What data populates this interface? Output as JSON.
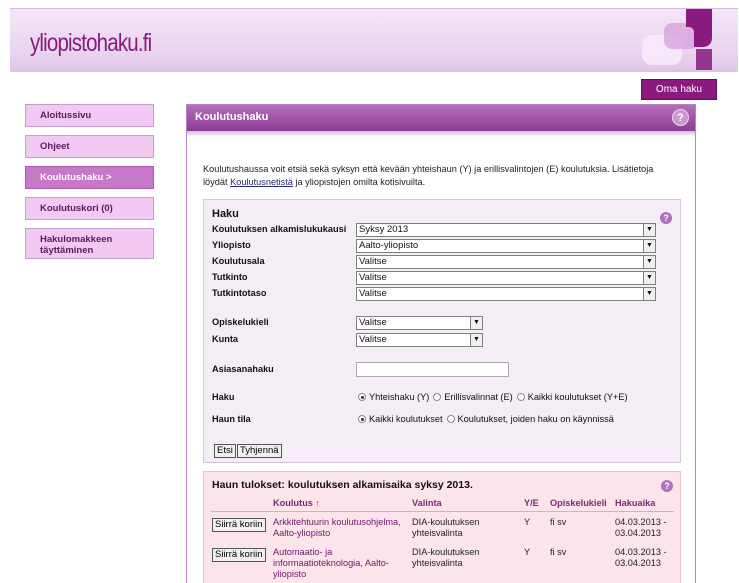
{
  "header": {
    "logo": "yliopistohaku.fi",
    "oma_haku": "Oma haku"
  },
  "sidebar": {
    "items": [
      {
        "label": "Aloitussivu"
      },
      {
        "label": "Ohjeet"
      },
      {
        "label": "Koulutushaku >"
      },
      {
        "label": "Koulutuskori (0)"
      },
      {
        "label": "Hakulomakkeen täyttäminen"
      }
    ]
  },
  "panel": {
    "title": "Koulutushaku",
    "help": "?",
    "intro_text": "Koulutushaussa voit etsiä sekä syksyn että kevään yhteishaun (Y) ja erillisvalintojen (E) koulutuksia. Lisätietoja löydät ",
    "intro_link": "Koulutusnetistä",
    "intro_tail": " ja yliopistojen omilta kotisivuilta."
  },
  "haku": {
    "title": "Haku",
    "help": "?",
    "fields": {
      "alkamis": {
        "label": "Koulutuksen alkamislukukausi",
        "value": "Syksy 2013"
      },
      "yliopisto": {
        "label": "Yliopisto",
        "value": "Aalto-yliopisto"
      },
      "ala": {
        "label": "Koulutusala",
        "value": "Valitse"
      },
      "tutkinto": {
        "label": "Tutkinto",
        "value": "Valitse"
      },
      "taso": {
        "label": "Tutkintotaso",
        "value": "Valitse"
      },
      "kieli": {
        "label": "Opiskelukieli",
        "value": "Valitse"
      },
      "kunta": {
        "label": "Kunta",
        "value": "Valitse"
      },
      "asiasana": {
        "label": "Asiasanahaku",
        "value": ""
      }
    },
    "haku_label": "Haku",
    "haku_options": [
      "Yhteishaku (Y)",
      "Erillisvalinnat (E)",
      "Kaikki koulutukset (Y+E)"
    ],
    "tila_label": "Haun tila",
    "tila_options": [
      "Kaikki koulutukset",
      "Koulutukset, joiden haku on käynnissä"
    ],
    "search_button": "Etsi",
    "clear_button": "Tyhjennä"
  },
  "results": {
    "title": "Haun tulokset: koulutuksen alkamisaika syksy 2013.",
    "help": "?",
    "columns": [
      "Koulutus ↑",
      "Valinta",
      "Y/E",
      "Opiskelukieli",
      "Hakuaika"
    ],
    "add_button": "Siirrä koriin",
    "rows": [
      {
        "koulutus": "Arkkitehtuurin koulutusohjelma, Aalto-yliopisto",
        "valinta": "DIA-koulutuksen yhteisvalinta",
        "ye": "Y",
        "kieli": "fi sv",
        "hakuaika": "04.03.2013 - 03.04.2013"
      },
      {
        "koulutus": "Automaatio- ja informaatioteknologia, Aalto-yliopisto",
        "valinta": "DIA-koulutuksen yhteisvalinta",
        "ye": "Y",
        "kieli": "fi sv",
        "hakuaika": "04.03.2013 - 03.04.2013"
      }
    ]
  },
  "colors": {
    "brand": "#8a1a7e",
    "panel_head": "#9b4aa3",
    "sidebar_item": "#f1c9f3",
    "sidebar_active": "#c678c9",
    "results_bg": "#fbe4ea"
  }
}
